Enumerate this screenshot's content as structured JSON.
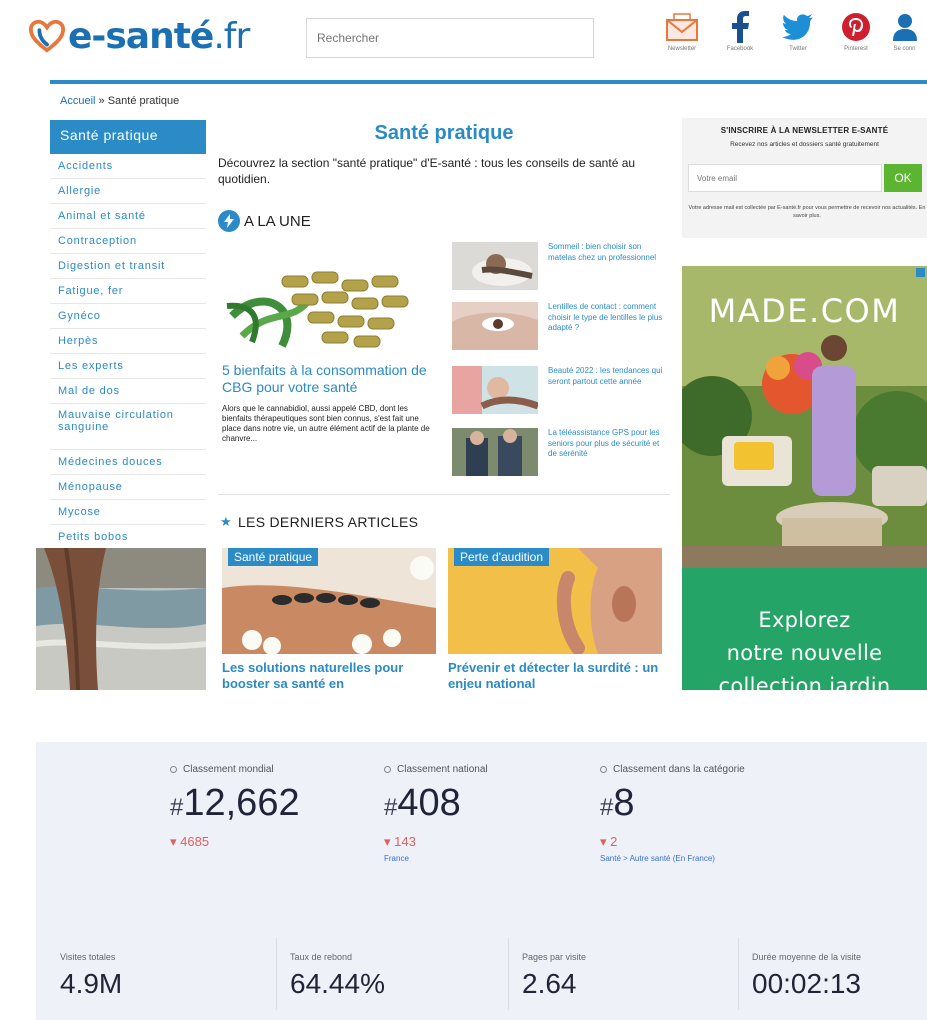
{
  "header": {
    "logo_text": "e-santé",
    "logo_tld": ".fr",
    "search_placeholder": "Rechercher",
    "social": [
      {
        "label": "Newsletter"
      },
      {
        "label": "Facebook"
      },
      {
        "label": "Twitter"
      },
      {
        "label": "Pinterest"
      },
      {
        "label": "Se conn"
      }
    ]
  },
  "breadcrumb": {
    "home": "Accueil",
    "sep": " » ",
    "current": "Santé pratique"
  },
  "sidebar": {
    "heading": "Santé pratique",
    "items": [
      "Accidents",
      "Allergie",
      "Animal et santé",
      "Contraception",
      "Digestion et transit",
      "Fatigue, fer",
      "Gynéco",
      "Herpès",
      "Les experts",
      "Mal de dos",
      "Mauvaise circulation sanguine",
      "Médecines douces",
      "Ménopause",
      "Mycose",
      "Petits bobos"
    ]
  },
  "main": {
    "title": "Santé pratique",
    "intro": "Découvrez la section \"santé pratique\" d'E-santé : tous les conseils de santé au quotidien.",
    "une_heading": "A LA UNE",
    "featured": {
      "title": "5 bienfaits à la consommation de CBG pour votre santé",
      "excerpt": "Alors que le cannabidiol, aussi appelé CBD, dont les bienfaits thérapeutiques sont bien connus, s'est fait une place dans notre vie, un autre élément actif de la plante de chanvre..."
    },
    "side_articles": [
      "Sommeil : bien choisir son matelas chez un professionnel",
      "Lentilles de contact : comment choisir le type de lentilles le plus adapté ?",
      "Beauté 2022 : les tendances qui seront partout cette année",
      "La téléassistance GPS pour les seniors pour plus de sécurité et de sérénité"
    ],
    "derniers_heading": "LES DERNIERS ARTICLES",
    "cards": [
      {
        "tag": "Santé pratique",
        "title": "Les solutions naturelles pour booster sa santé en"
      },
      {
        "tag": "Perte d'audition",
        "title": "Prévenir et détecter la surdité : un enjeu national"
      }
    ]
  },
  "newsletter": {
    "title": "S'INSCRIRE À LA NEWSLETTER E-SANTÉ",
    "subtitle": "Recevez nos articles et dossiers santé gratuitement",
    "email_placeholder": "Votre email",
    "ok_label": "OK",
    "note": "Votre adresse mail est collectée par E-santé.fr pour vous permettre de recevoir nos actualités. En savoir plus."
  },
  "ad": {
    "brand": "MADE.COM",
    "tagline_lines": [
      "Explorez",
      "notre nouvelle",
      "collection jardin"
    ],
    "colors": {
      "green": "#24a467"
    }
  },
  "stats": {
    "ranks": [
      {
        "label": "Classement mondial",
        "hash": "#",
        "value": "12,662",
        "change": "▾ 4685",
        "sub": ""
      },
      {
        "label": "Classement national",
        "hash": "#",
        "value": "408",
        "change": "▾ 143",
        "sub": "France"
      },
      {
        "label": "Classement dans la catégorie",
        "hash": "#",
        "value": "8",
        "change": "▾ 2",
        "sub": "Santé > Autre santé (En France)"
      }
    ],
    "metrics": [
      {
        "label": "Visites totales",
        "value": "4.9M"
      },
      {
        "label": "Taux de rebond",
        "value": "64.44%"
      },
      {
        "label": "Pages par visite",
        "value": "2.64"
      },
      {
        "label": "Durée moyenne de la visite",
        "value": "00:02:13"
      }
    ]
  },
  "colors": {
    "brand_blue": "#2a8bc7",
    "logo_blue": "#1b6fb3",
    "ok_green": "#5cb531",
    "down_red": "#e06060"
  }
}
